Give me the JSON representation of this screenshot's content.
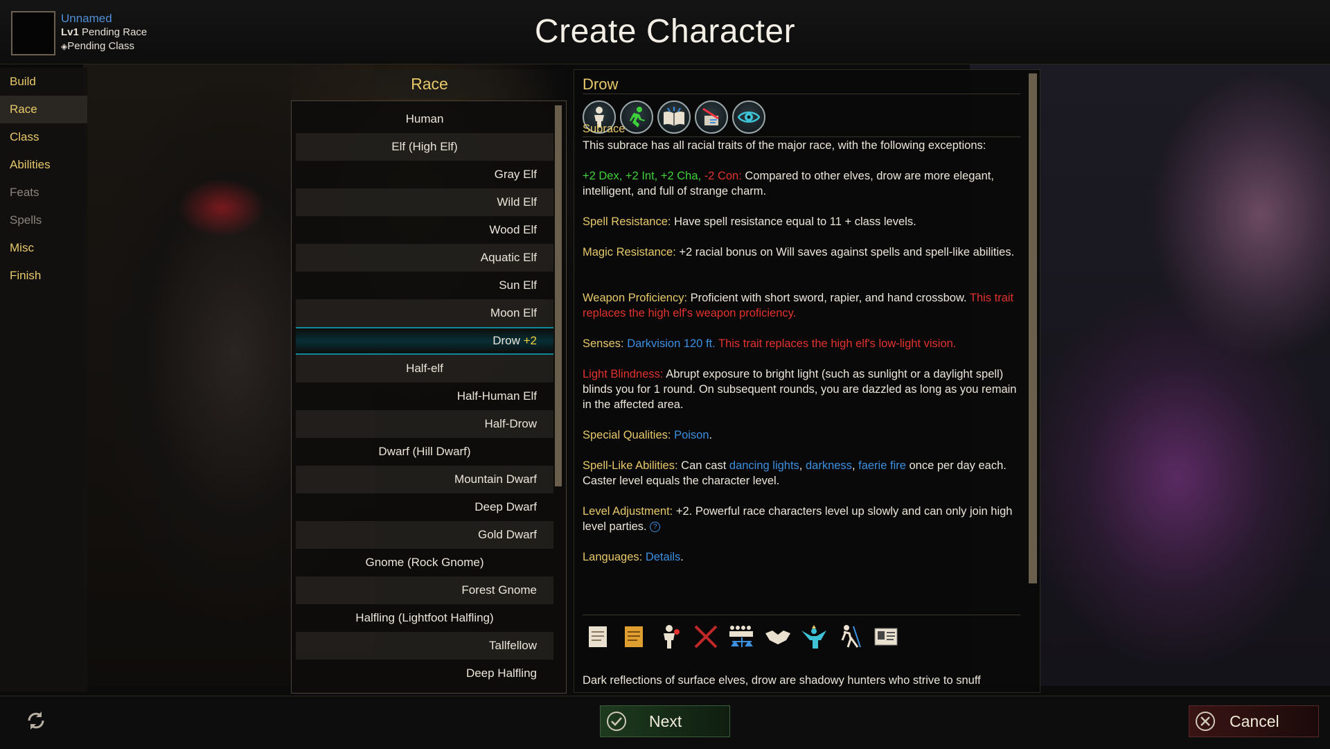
{
  "header": {
    "title": "Create Character",
    "character": {
      "name": "Unnamed",
      "level_prefix": "Lv1",
      "race_status": "Pending Race",
      "class_status": "Pending Class"
    }
  },
  "nav": {
    "items": [
      {
        "label": "Build",
        "state": "enabled"
      },
      {
        "label": "Race",
        "state": "active"
      },
      {
        "label": "Class",
        "state": "enabled"
      },
      {
        "label": "Abilities",
        "state": "enabled"
      },
      {
        "label": "Feats",
        "state": "disabled"
      },
      {
        "label": "Spells",
        "state": "disabled"
      },
      {
        "label": "Misc",
        "state": "enabled"
      },
      {
        "label": "Finish",
        "state": "enabled"
      }
    ]
  },
  "race_panel": {
    "title": "Race",
    "races": [
      {
        "label": "Human",
        "align": "center"
      },
      {
        "label": "Elf (High Elf)",
        "align": "center"
      },
      {
        "label": "Gray Elf",
        "align": "right"
      },
      {
        "label": "Wild Elf",
        "align": "right"
      },
      {
        "label": "Wood Elf",
        "align": "right"
      },
      {
        "label": "Aquatic Elf",
        "align": "right"
      },
      {
        "label": "Sun Elf",
        "align": "right"
      },
      {
        "label": "Moon Elf",
        "align": "right"
      },
      {
        "label": "Drow",
        "align": "right",
        "selected": true,
        "bonus": "+2"
      },
      {
        "label": "Half-elf",
        "align": "center"
      },
      {
        "label": "Half-Human Elf",
        "align": "right"
      },
      {
        "label": "Half-Drow",
        "align": "right"
      },
      {
        "label": "Dwarf (Hill Dwarf)",
        "align": "center"
      },
      {
        "label": "Mountain Dwarf",
        "align": "right"
      },
      {
        "label": "Deep Dwarf",
        "align": "right"
      },
      {
        "label": "Gold Dwarf",
        "align": "right"
      },
      {
        "label": "Gnome (Rock Gnome)",
        "align": "center"
      },
      {
        "label": "Forest Gnome",
        "align": "right"
      },
      {
        "label": "Halfling (Lightfoot Halfling)",
        "align": "center"
      },
      {
        "label": "Tallfellow",
        "align": "right"
      },
      {
        "label": "Deep Halfling",
        "align": "right"
      }
    ]
  },
  "detail": {
    "name": "Drow",
    "trait_icons": [
      "humanoid-icon",
      "runner-icon",
      "open-book-icon",
      "quill-scroll-icon",
      "eye-icon"
    ],
    "subrace_heading": "Subrace",
    "intro": "This subrace has all racial traits of the major race, with the following exceptions:",
    "stats": {
      "dex": "+2 Dex,",
      "int": "+2 Int,",
      "cha": "+2 Cha,",
      "con": "-2 Con:"
    },
    "stats_text": "Compared to other elves, drow are more elegant, intelligent, and full of strange charm.",
    "spell_resistance": {
      "label": "Spell Resistance:",
      "text": "Have spell resistance equal to 11 + class levels."
    },
    "magic_resistance": {
      "label": "Magic Resistance:",
      "text": "+2 racial bonus on Will saves against spells and spell-like abilities."
    },
    "weapon_proficiency": {
      "label": "Weapon Proficiency:",
      "text": "Proficient with short sword, rapier, and hand crossbow.",
      "note": "This trait replaces the high elf's weapon proficiency."
    },
    "senses": {
      "label": "Senses:",
      "link": "Darkvision 120 ft.",
      "note": "This trait replaces the high elf's low-light vision."
    },
    "light_blindness": {
      "label": "Light Blindness:",
      "text": "Abrupt exposure to bright light (such as sunlight or a daylight spell) blinds you for 1 round. On subsequent rounds, you are dazzled as long as you remain in the affected area."
    },
    "special_qualities": {
      "label": "Special Qualities:",
      "link": "Poison",
      "end": "."
    },
    "spell_like": {
      "label": "Spell-Like Abilities:",
      "pre": "Can cast",
      "link1": "dancing lights",
      "sep1": ",",
      "link2": "darkness",
      "sep2": ",",
      "link3": "faerie fire",
      "post": "once per day each. Caster level equals the character level."
    },
    "level_adjustment": {
      "label": "Level Adjustment:",
      "text": "+2. Powerful race characters level up slowly and can only join high level parties."
    },
    "languages": {
      "label": "Languages:",
      "link": "Details",
      "end": "."
    },
    "bottom_icons": [
      "scroll-icon",
      "orange-scroll-icon",
      "figure-with-pin-icon",
      "crossed-swords-icon",
      "crowd-scales-icon",
      "handshake-icon",
      "winged-figure-icon",
      "climber-icon",
      "id-card-icon"
    ],
    "description": "Dark reflections of surface elves, drow are shadowy hunters who strive to snuff"
  },
  "footer": {
    "next_label": "Next",
    "cancel_label": "Cancel"
  },
  "colors": {
    "gold": "#e7c96b",
    "blue": "#3d8fe0",
    "red": "#e2322f",
    "green": "#3ed13a",
    "selection": "#0e8a9c"
  }
}
